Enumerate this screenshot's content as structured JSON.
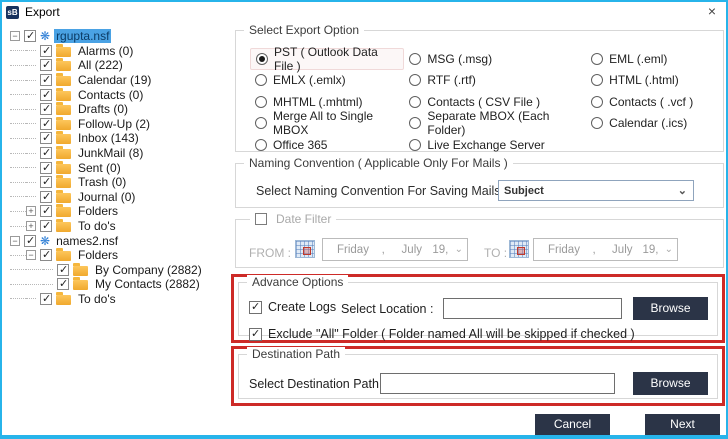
{
  "icons": {
    "close": "×",
    "check": "✓",
    "notes": "❋",
    "chevron": "⌄",
    "minus": "−",
    "plus": "+"
  },
  "window": {
    "title": "Export",
    "border_color": "#27b4ea",
    "accent_red": "#cd2a27",
    "button_color": "#2b3447"
  },
  "tree": {
    "items": [
      {
        "label": "rgupta.nsf",
        "level": 0,
        "expander": "minus",
        "checked": true,
        "icon": "notes",
        "selected": true
      },
      {
        "label": "Alarms (0)",
        "level": 1,
        "expander": "none",
        "checked": true,
        "icon": "folder",
        "selected": false
      },
      {
        "label": "All (222)",
        "level": 1,
        "expander": "none",
        "checked": true,
        "icon": "folder",
        "selected": false
      },
      {
        "label": "Calendar (19)",
        "level": 1,
        "expander": "none",
        "checked": true,
        "icon": "folder",
        "selected": false
      },
      {
        "label": "Contacts (0)",
        "level": 1,
        "expander": "none",
        "checked": true,
        "icon": "folder",
        "selected": false
      },
      {
        "label": "Drafts (0)",
        "level": 1,
        "expander": "none",
        "checked": true,
        "icon": "folder",
        "selected": false
      },
      {
        "label": "Follow-Up (2)",
        "level": 1,
        "expander": "none",
        "checked": true,
        "icon": "folder",
        "selected": false
      },
      {
        "label": "Inbox (143)",
        "level": 1,
        "expander": "none",
        "checked": true,
        "icon": "folder",
        "selected": false
      },
      {
        "label": "JunkMail (8)",
        "level": 1,
        "expander": "none",
        "checked": true,
        "icon": "folder",
        "selected": false
      },
      {
        "label": "Sent (0)",
        "level": 1,
        "expander": "none",
        "checked": true,
        "icon": "folder",
        "selected": false
      },
      {
        "label": "Trash (0)",
        "level": 1,
        "expander": "none",
        "checked": true,
        "icon": "folder",
        "selected": false
      },
      {
        "label": "Journal (0)",
        "level": 1,
        "expander": "none",
        "checked": true,
        "icon": "folder",
        "selected": false
      },
      {
        "label": "Folders",
        "level": 1,
        "expander": "plus",
        "checked": true,
        "icon": "folder",
        "selected": false
      },
      {
        "label": "To do's",
        "level": 1,
        "expander": "plus",
        "checked": true,
        "icon": "folder",
        "selected": false
      },
      {
        "label": "names2.nsf",
        "level": 0,
        "expander": "minus",
        "checked": true,
        "icon": "notes",
        "selected": false
      },
      {
        "label": "Folders",
        "level": 1,
        "expander": "minus",
        "checked": true,
        "icon": "folder",
        "selected": false
      },
      {
        "label": "By Company (2882)",
        "level": 2,
        "expander": "none",
        "checked": true,
        "icon": "folder",
        "selected": false
      },
      {
        "label": "My Contacts (2882)",
        "level": 2,
        "expander": "none",
        "checked": true,
        "icon": "folder",
        "selected": false
      },
      {
        "label": "To do's",
        "level": 1,
        "expander": "none",
        "checked": true,
        "icon": "folder",
        "selected": false
      }
    ]
  },
  "export_options": {
    "title": "Select Export Option",
    "columns": [
      {
        "options": [
          {
            "label": "PST ( Outlook Data File )",
            "selected": true
          },
          {
            "label": "EMLX (.emlx)",
            "selected": false
          },
          {
            "label": "MHTML (.mhtml)",
            "selected": false
          },
          {
            "label": "Merge All to Single MBOX",
            "selected": false
          },
          {
            "label": "Office 365",
            "selected": false
          }
        ]
      },
      {
        "options": [
          {
            "label": "MSG (.msg)",
            "selected": false
          },
          {
            "label": "RTF (.rtf)",
            "selected": false
          },
          {
            "label": "Contacts ( CSV File )",
            "selected": false
          },
          {
            "label": "Separate MBOX (Each Folder)",
            "selected": false
          },
          {
            "label": "Live Exchange Server",
            "selected": false
          }
        ]
      },
      {
        "options": [
          {
            "label": "EML (.eml)",
            "selected": false
          },
          {
            "label": "HTML (.html)",
            "selected": false
          },
          {
            "label": "Contacts ( .vcf )",
            "selected": false
          },
          {
            "label": "Calendar (.ics)",
            "selected": false
          }
        ]
      }
    ]
  },
  "naming": {
    "title": "Naming Convention ( Applicable Only For Mails )",
    "label": "Select Naming Convention For Saving Mails",
    "selected_value": "Subject"
  },
  "date_filter": {
    "title": "Date Filter",
    "checked": false,
    "from_label": "FROM :",
    "to_label": "TO :",
    "from": {
      "day": "Friday",
      "comma": ",",
      "month": "July",
      "daynum": "19,"
    },
    "to": {
      "day": "Friday",
      "comma": ",",
      "month": "July",
      "daynum": "19,"
    }
  },
  "advance": {
    "title": "Advance Options",
    "create_logs_label": "Create Logs",
    "create_logs_checked": true,
    "select_location_label": "Select Location :",
    "location_value": "",
    "browse_label": "Browse",
    "exclude_label": "Exclude \"All\" Folder ( Folder named All will be skipped if checked )",
    "exclude_checked": true
  },
  "destination": {
    "title": "Destination Path",
    "label": "Select Destination Path",
    "path_value": "",
    "browse_label": "Browse"
  },
  "footer": {
    "cancel_label": "Cancel",
    "next_label": "Next"
  }
}
